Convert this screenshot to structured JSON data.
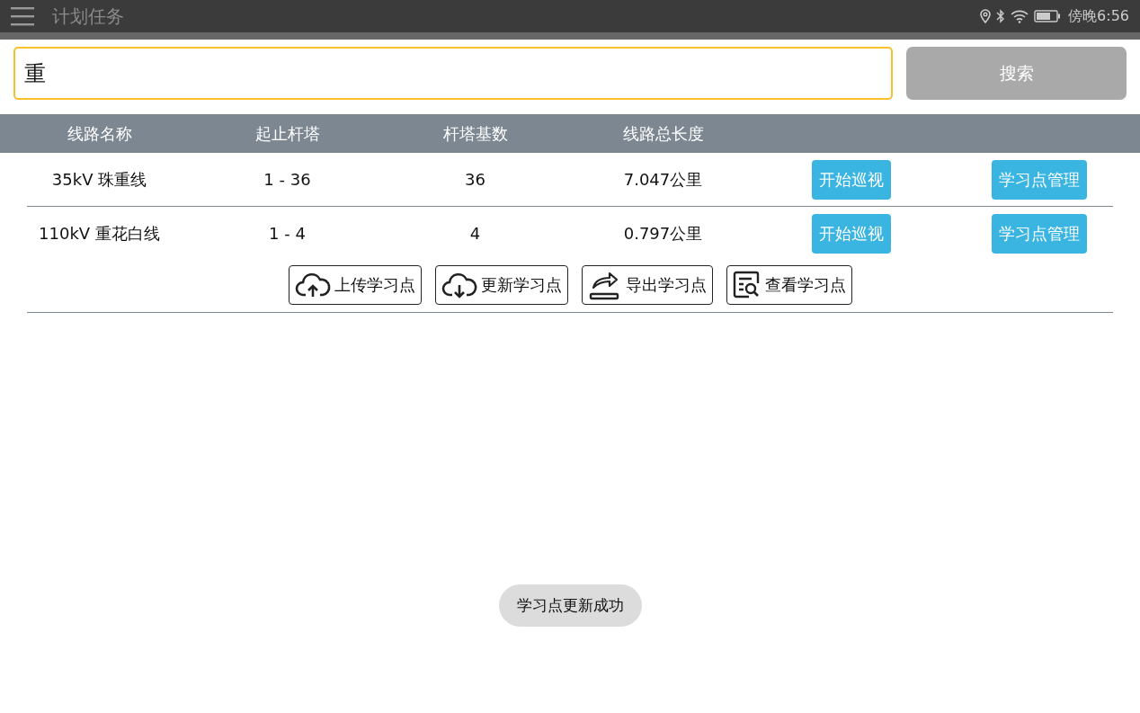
{
  "status_bar": {
    "title": "计划任务",
    "time": "傍晚6:56"
  },
  "search": {
    "value": "重",
    "button": "搜索",
    "button_disabled": true
  },
  "table": {
    "columns": [
      "线路名称",
      "起止杆塔",
      "杆塔基数",
      "线路总长度"
    ],
    "rows": [
      {
        "name": "35kV 珠重线",
        "range": "1 - 36",
        "count": "36",
        "length": "7.047公里",
        "buttons": [
          "开始巡视",
          "学习点管理"
        ],
        "actions": []
      },
      {
        "name": "110kV 重花白线",
        "range": "1 - 4",
        "count": "4",
        "length": "0.797公里",
        "buttons": [
          "开始巡视",
          "学习点管理"
        ],
        "actions": [
          {
            "kind": "upload",
            "label": "上传学习点"
          },
          {
            "kind": "download",
            "label": "更新学习点"
          },
          {
            "kind": "export",
            "label": "导出学习点"
          },
          {
            "kind": "view",
            "label": "查看学习点"
          }
        ]
      }
    ]
  },
  "toast": "学习点更新成功"
}
